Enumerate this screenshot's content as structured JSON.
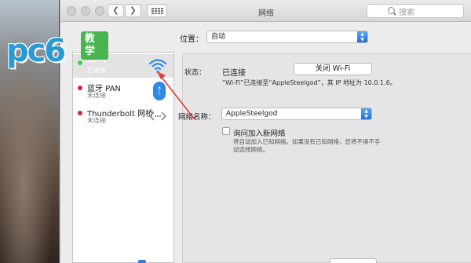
{
  "watermark": {
    "brand": "pc6",
    "badge": "教学"
  },
  "window": {
    "title": "网络",
    "search_placeholder": "搜索"
  },
  "location": {
    "label": "位置：",
    "value": "自动"
  },
  "services": [
    {
      "name": "Wi-Fi",
      "status": "已连接",
      "state_color": "#3ccf4e",
      "icon": "wifi-icon",
      "selected": true
    },
    {
      "name": "蓝牙 PAN",
      "status": "未连接",
      "state_color": "#d9252c",
      "icon": "bluetooth-icon",
      "selected": false
    },
    {
      "name": "Thunderbolt 网桥",
      "status": "未连接",
      "state_color": "#d9252c",
      "icon": "thunderbolt-bridge-icon",
      "selected": false
    }
  ],
  "detail": {
    "status_label": "状态：",
    "status_value": "已连接",
    "toggle_button": "关闭 Wi-Fi",
    "status_description": "“Wi-Fi”已连接至“AppleSteelgod”，其 IP 地址为 10.0.1.6。",
    "network_name_label": "网络名称：",
    "network_name_value": "AppleSteelgod",
    "ask_join_label": "询问加入新网络",
    "ask_join_description": "将自动加入已知网络。如果没有已知网络，您将不得不手动选择网络。"
  },
  "colors": {
    "accent": "#2e7ce6",
    "connected": "#3ccf4e",
    "disconnected": "#d9252c",
    "annotation": "#e53935"
  }
}
